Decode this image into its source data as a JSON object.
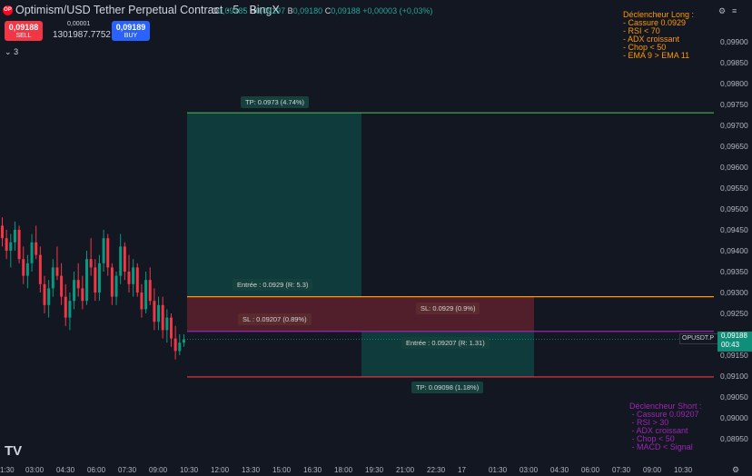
{
  "header": {
    "logo_text": "OP",
    "symbol_line": "Optimism/USD Tether Perpetual Contract · 5 · BingX",
    "ohlc": {
      "o_key": "O",
      "o": "0,09185",
      "h_key": "H",
      "h": "0,09197",
      "b_key": "B",
      "b": "0,09180",
      "c_key": "C",
      "c": "0,09188",
      "change": "+0,00003 (+0,03%)"
    }
  },
  "trade": {
    "sell_price": "0,09188",
    "sell_label": "SELL",
    "buy_price": "0,09189",
    "buy_label": "BUY",
    "spread": "0,00001",
    "quantity": "1301987.7752"
  },
  "indicators_toggle": "3",
  "price_axis": [
    "0,09900",
    "0,09850",
    "0,09800",
    "0,09750",
    "0,09700",
    "0,09650",
    "0,09600",
    "0,09550",
    "0,09500",
    "0,09450",
    "0,09400",
    "0,09350",
    "0,09300",
    "0,09250",
    "0,09200",
    "0,09150",
    "0,09100",
    "0,09050",
    "0,09000",
    "0,08950"
  ],
  "time_axis": [
    "03:00",
    "04:30",
    "06:00",
    "07:30",
    "09:00",
    "10:30",
    "12:00",
    "13:30",
    "15:00",
    "16:30",
    "18:00",
    "19:30",
    "21:00",
    "22:30",
    "17",
    "01:30",
    "03:00",
    "04:30",
    "06:00",
    "07:30",
    "09:00",
    "10:30"
  ],
  "time_axis_left_partial": "1:30",
  "current_price": {
    "symbol": "OPUSDT.P",
    "price": "0,09188",
    "countdown": "00:43",
    "color": "#089981"
  },
  "long_position": {
    "tp_label": "TP: 0.0973 (4.74%)",
    "entry_label": "Entrée : 0.0929 (R: 5.3)",
    "sl_label": "SL : 0.09207 (0.89%)",
    "tp": 0.0973,
    "entry": 0.0929,
    "sl": 0.09207
  },
  "short_position": {
    "sl_label": "SL: 0.0929 (0.9%)",
    "entry_label": "Entrée : 0.09207 (R: 1.31)",
    "tp_label": "TP: 0.09098 (1.18%)",
    "sl": 0.0929,
    "entry": 0.09207,
    "tp": 0.09098
  },
  "long_box": "Déclencheur Long :\n- Cassure 0.0929\n- RSI < 70\n- ADX croissant\n- Chop < 50\n- EMA 9 > EMA 11",
  "short_box": "Déclencheur Short :\n - Cassure 0.09207\n - RSI > 30\n - ADX croissant\n - Chop < 50\n - MACD < Signal",
  "watermark": "TV",
  "colors": {
    "bg": "#131722",
    "up": "#089981",
    "down": "#f23645",
    "tp_line": "#4caf50",
    "entry_line": "#ff9800",
    "sl_line": "#f23645",
    "purple": "#9c27b0"
  },
  "chart_data": {
    "type": "candlestick",
    "candles": [
      [
        0.0946,
        0.0948,
        0.0941,
        0.0943
      ],
      [
        0.0943,
        0.0945,
        0.0938,
        0.094
      ],
      [
        0.094,
        0.0944,
        0.0936,
        0.0942
      ],
      [
        0.0942,
        0.0947,
        0.094,
        0.0945
      ],
      [
        0.0945,
        0.0946,
        0.0937,
        0.0938
      ],
      [
        0.0938,
        0.0941,
        0.0932,
        0.0934
      ],
      [
        0.0934,
        0.0939,
        0.0931,
        0.0937
      ],
      [
        0.0937,
        0.0944,
        0.0935,
        0.0942
      ],
      [
        0.0942,
        0.0946,
        0.0938,
        0.0939
      ],
      [
        0.0939,
        0.0941,
        0.093,
        0.0932
      ],
      [
        0.0932,
        0.0934,
        0.0925,
        0.0927
      ],
      [
        0.0927,
        0.0933,
        0.0924,
        0.0931
      ],
      [
        0.0931,
        0.0938,
        0.0929,
        0.0936
      ],
      [
        0.0936,
        0.0941,
        0.0933,
        0.0934
      ],
      [
        0.0934,
        0.0937,
        0.0927,
        0.0929
      ],
      [
        0.0929,
        0.0932,
        0.0922,
        0.0924
      ],
      [
        0.0924,
        0.093,
        0.0921,
        0.0928
      ],
      [
        0.0928,
        0.0935,
        0.0926,
        0.0933
      ],
      [
        0.0933,
        0.0937,
        0.0929,
        0.0931
      ],
      [
        0.0931,
        0.0934,
        0.0926,
        0.0928
      ],
      [
        0.0928,
        0.094,
        0.0927,
        0.0938
      ],
      [
        0.0938,
        0.0943,
        0.0934,
        0.0936
      ],
      [
        0.0936,
        0.0938,
        0.0928,
        0.093
      ],
      [
        0.093,
        0.0939,
        0.0928,
        0.0937
      ],
      [
        0.0937,
        0.0945,
        0.0935,
        0.0943
      ],
      [
        0.0943,
        0.0944,
        0.0934,
        0.0936
      ],
      [
        0.0936,
        0.0937,
        0.0927,
        0.0929
      ],
      [
        0.0929,
        0.0935,
        0.0927,
        0.0934
      ],
      [
        0.0934,
        0.0944,
        0.0932,
        0.0941
      ],
      [
        0.0941,
        0.0942,
        0.0933,
        0.0935
      ],
      [
        0.0935,
        0.0939,
        0.093,
        0.0932
      ],
      [
        0.0932,
        0.0938,
        0.0929,
        0.0936
      ],
      [
        0.0936,
        0.0937,
        0.0929,
        0.093
      ],
      [
        0.093,
        0.0932,
        0.0924,
        0.0926
      ],
      [
        0.0926,
        0.0935,
        0.0925,
        0.0933
      ],
      [
        0.0933,
        0.0936,
        0.0927,
        0.0928
      ],
      [
        0.0928,
        0.0931,
        0.0921,
        0.0923
      ],
      [
        0.0923,
        0.0929,
        0.0921,
        0.0927
      ],
      [
        0.0927,
        0.0929,
        0.0919,
        0.0921
      ],
      [
        0.0921,
        0.0926,
        0.0918,
        0.0924
      ],
      [
        0.0924,
        0.0925,
        0.0917,
        0.0919
      ],
      [
        0.0919,
        0.0922,
        0.0914,
        0.0916
      ],
      [
        0.0916,
        0.092,
        0.0915,
        0.0918
      ],
      [
        0.0918,
        0.092,
        0.0917,
        0.09188
      ]
    ]
  }
}
